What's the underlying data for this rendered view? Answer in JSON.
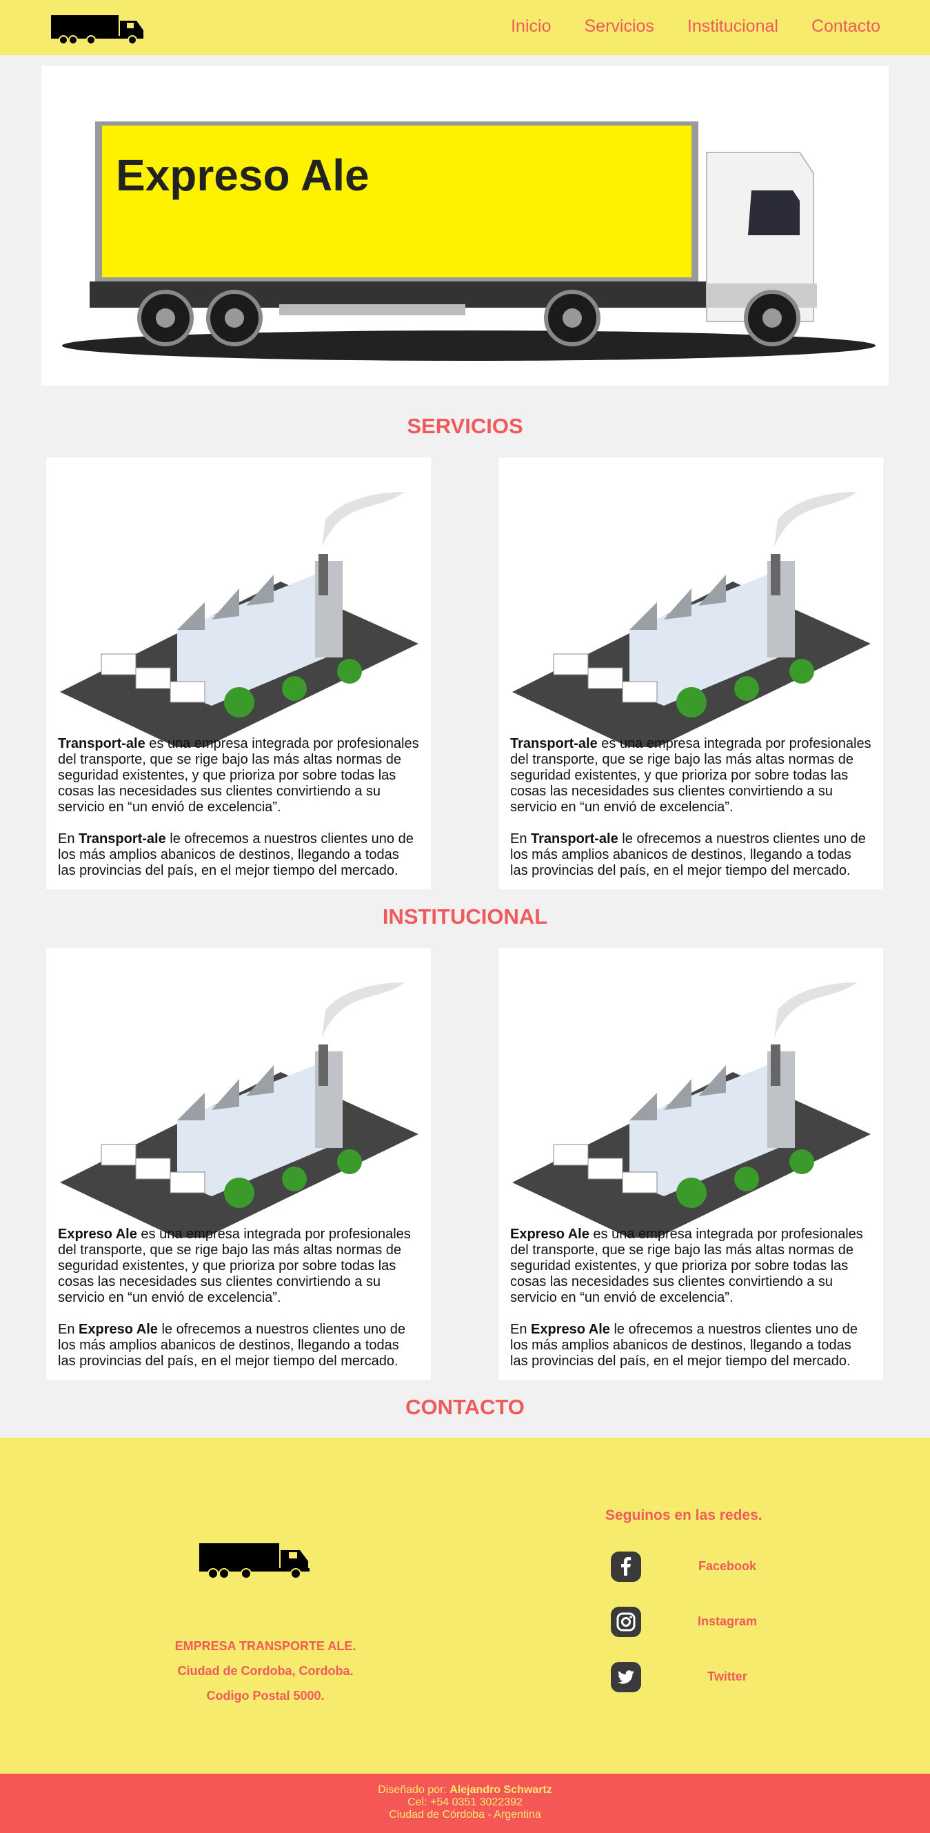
{
  "header": {
    "nav": [
      "Inicio",
      "Servicios",
      "Institucional",
      "Contacto"
    ]
  },
  "hero": {
    "sign_text": "Expreso Ale"
  },
  "servicios": {
    "title": "SERVICIOS",
    "cards": [
      {
        "p1_bold": "Transport-ale",
        "p1_rest": " es una empresa integrada por profesionales del transporte, que se rige bajo las más altas normas de seguridad existentes, y que prioriza por sobre todas las cosas las necesidades sus clientes convirtiendo a su servicio en “un envió de excelencia”.",
        "p2_pre": "En ",
        "p2_bold": "Transport-ale",
        "p2_rest": " le ofrecemos a nuestros clientes uno de los más amplios abanicos de destinos, llegando a todas las provincias del país, en el mejor tiempo del mercado."
      },
      {
        "p1_bold": "Transport-ale",
        "p1_rest": " es una empresa integrada por profesionales del transporte, que se rige bajo las más altas normas de seguridad existentes, y que prioriza por sobre todas las cosas las necesidades sus clientes convirtiendo a su servicio en “un envió de excelencia”.",
        "p2_pre": "En ",
        "p2_bold": "Transport-ale",
        "p2_rest": " le ofrecemos a nuestros clientes uno de los más amplios abanicos de destinos, llegando a todas las provincias del país, en el mejor tiempo del mercado."
      }
    ]
  },
  "institucional": {
    "title": "INSTITUCIONAL",
    "cards": [
      {
        "p1_bold": "Expreso Ale",
        "p1_rest": " es una empresa integrada por profesionales del transporte, que se rige bajo las más altas normas de seguridad existentes, y que prioriza por sobre todas las cosas las necesidades sus clientes convirtiendo a su servicio en “un envió de excelencia”.",
        "p2_pre": "En ",
        "p2_bold": "Expreso Ale",
        "p2_rest": " le ofrecemos a nuestros clientes uno de los más amplios abanicos de destinos, llegando a todas las provincias del país, en el mejor tiempo del mercado."
      },
      {
        "p1_bold": "Expreso Ale",
        "p1_rest": " es una empresa integrada por profesionales del transporte, que se rige bajo las más altas normas de seguridad existentes, y que prioriza por sobre todas las cosas las necesidades sus clientes convirtiendo a su servicio en “un envió de excelencia”.",
        "p2_pre": "En ",
        "p2_bold": "Expreso Ale",
        "p2_rest": " le ofrecemos a nuestros clientes uno de los más amplios abanicos de destinos, llegando a todas las provincias del país, en el mejor tiempo del mercado."
      }
    ]
  },
  "contacto": {
    "title": "CONTACTO",
    "address": [
      "EMPRESA TRANSPORTE ALE.",
      "Ciudad de Cordoba, Cordoba.",
      "Codigo Postal 5000."
    ],
    "social_title": "Seguinos en las redes.",
    "social": [
      {
        "label": "Facebook",
        "icon": "facebook-icon"
      },
      {
        "label": "Instagram",
        "icon": "instagram-icon"
      },
      {
        "label": "Twitter",
        "icon": "twitter-icon"
      }
    ]
  },
  "footer": {
    "designed_prefix": "Diseñado por: ",
    "designer": "Alejandro Schwartz",
    "phone": "Cel: +54 0351 3022392",
    "city": "Ciudad de Córdoba - Argentina"
  },
  "colors": {
    "yellow": "#f7eb6e",
    "accent": "#f05a5a",
    "bottom_bar": "#f55656",
    "background": "#f1f1f1",
    "sign_yellow": "#fff200"
  }
}
